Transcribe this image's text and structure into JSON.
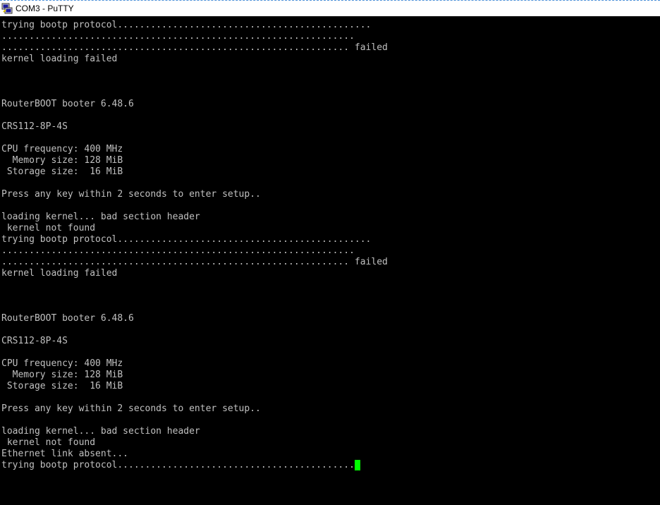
{
  "window": {
    "title": "COM3 - PuTTY",
    "icon": "putty-icon"
  },
  "terminal": {
    "foreground": "#c0c0c0",
    "background": "#000000",
    "cursor_color": "#00ff00",
    "lines": [
      "trying bootp protocol..............................................",
      "................................................................",
      "............................................................... failed",
      "kernel loading failed",
      "",
      "",
      "",
      "RouterBOOT booter 6.48.6",
      "",
      "CRS112-8P-4S",
      "",
      "CPU frequency: 400 MHz",
      "  Memory size: 128 MiB",
      " Storage size:  16 MiB",
      "",
      "Press any key within 2 seconds to enter setup..",
      "",
      "loading kernel... bad section header",
      " kernel not found",
      "trying bootp protocol..............................................",
      "................................................................",
      "............................................................... failed",
      "kernel loading failed",
      "",
      "",
      "",
      "RouterBOOT booter 6.48.6",
      "",
      "CRS112-8P-4S",
      "",
      "CPU frequency: 400 MHz",
      "  Memory size: 128 MiB",
      " Storage size:  16 MiB",
      "",
      "Press any key within 2 seconds to enter setup..",
      "",
      "loading kernel... bad section header",
      " kernel not found",
      "Ethernet link absent...",
      "trying bootp protocol..........................................."
    ]
  }
}
